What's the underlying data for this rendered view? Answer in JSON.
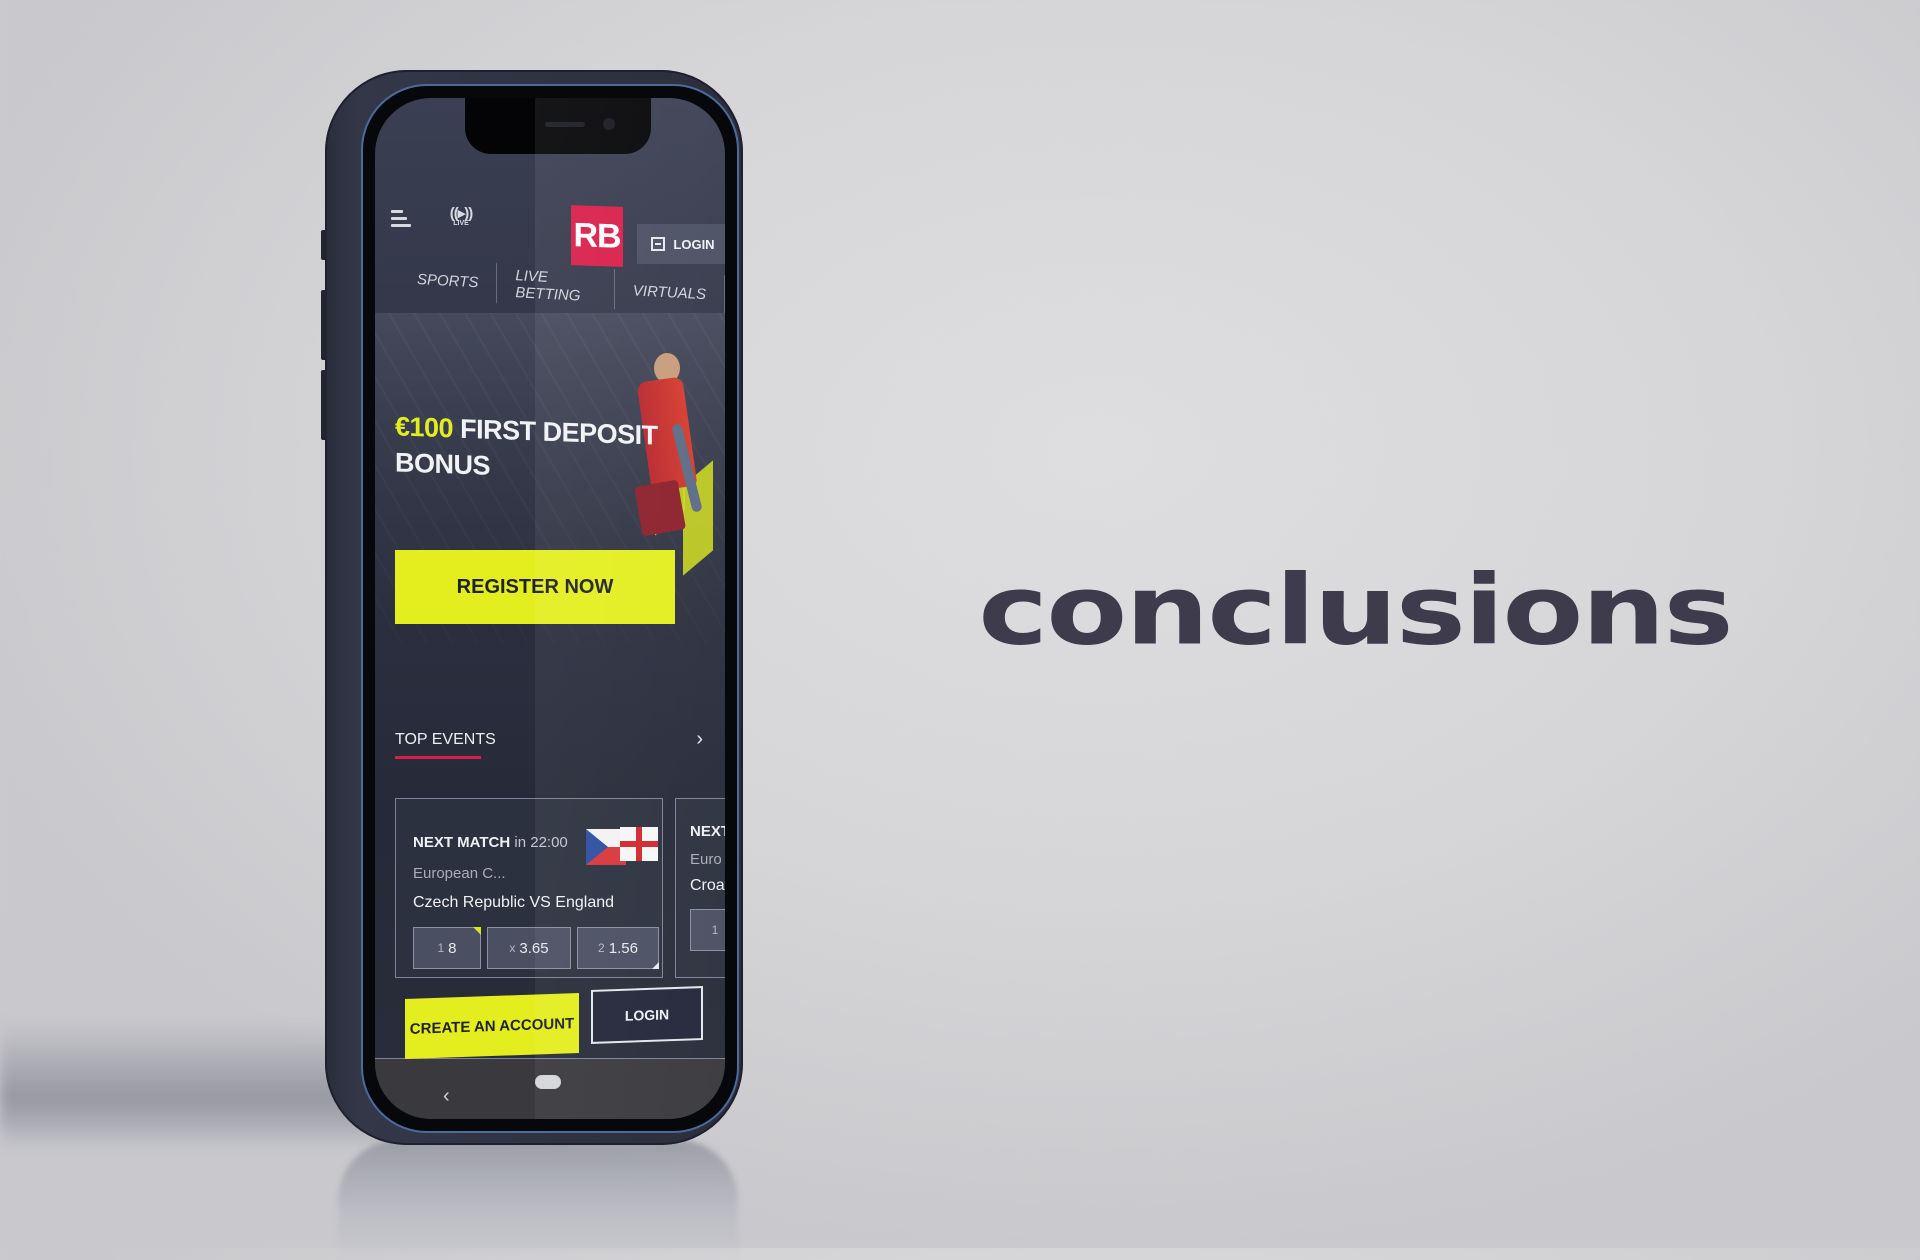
{
  "headline": "conclusions",
  "app": {
    "brand_logo_text": "RB",
    "brand_color": "#d91e4a",
    "accent_color": "#e4ee1e",
    "header": {
      "menu_icon": "hamburger-menu-icon",
      "live_icon": "live-broadcast-icon",
      "live_label": "LIVE",
      "login_label": "LOGIN",
      "login_icon": "login-key-icon"
    },
    "tabs": [
      {
        "label": "SPORTS"
      },
      {
        "label": "LIVE BETTING"
      },
      {
        "label": "VIRTUALS"
      }
    ],
    "promo": {
      "amount": "€100",
      "headline_rest": "FIRST DEPOSIT",
      "headline_line2": "BONUS",
      "cta_label": "REGISTER NOW"
    },
    "top_events": {
      "title": "TOP EVENTS",
      "chevron_icon": "chevron-right-icon",
      "cards": [
        {
          "label": "NEXT MATCH",
          "time": "in 22:00",
          "competition": "European C...",
          "teams": "Czech Republic VS England",
          "flags": [
            "czech-republic-flag",
            "england-flag"
          ],
          "odds": [
            {
              "key": "1",
              "value": "8"
            },
            {
              "key": "x",
              "value": "3.65"
            },
            {
              "key": "2",
              "value": "1.56"
            }
          ]
        },
        {
          "label": "NEXT",
          "competition": "Euro",
          "teams": "Croat",
          "odds": [
            {
              "key": "1",
              "value": ""
            }
          ]
        }
      ]
    },
    "bottom_actions": {
      "create_account_label": "CREATE AN ACCOUNT",
      "login_label": "LOGIN"
    },
    "system_nav": {
      "back_glyph": "‹",
      "back_icon": "back-chevron-icon",
      "home_icon": "home-pill-icon"
    }
  }
}
